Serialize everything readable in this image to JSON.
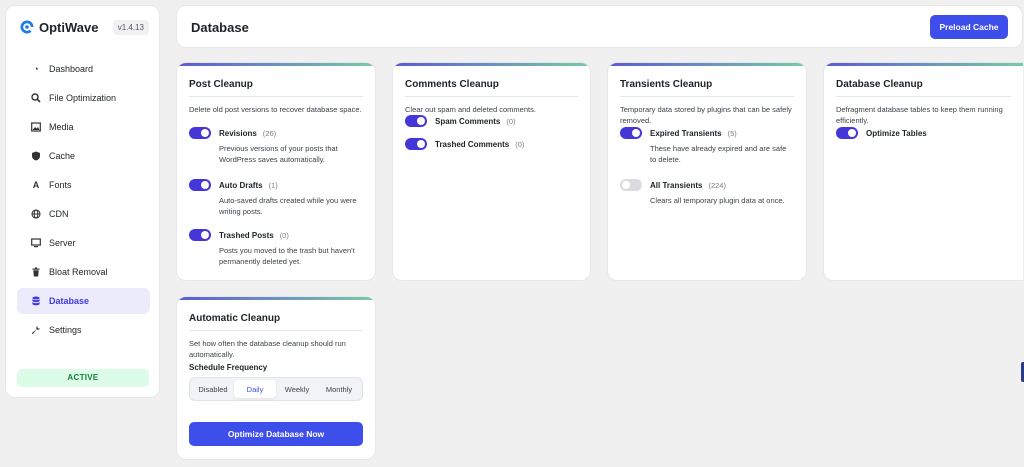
{
  "brand": {
    "name": "OptiWave",
    "version": "v1.4.13"
  },
  "sidebar": {
    "items": [
      {
        "label": "Dashboard",
        "icon": "dashboard-icon"
      },
      {
        "label": "File Optimization",
        "icon": "search-icon"
      },
      {
        "label": "Media",
        "icon": "image-icon"
      },
      {
        "label": "Cache",
        "icon": "shield-icon"
      },
      {
        "label": "Fonts",
        "icon": "font-icon"
      },
      {
        "label": "CDN",
        "icon": "globe-icon"
      },
      {
        "label": "Server",
        "icon": "monitor-icon"
      },
      {
        "label": "Bloat Removal",
        "icon": "trash-icon"
      },
      {
        "label": "Database",
        "icon": "database-icon",
        "active": true
      },
      {
        "label": "Settings",
        "icon": "wrench-icon"
      }
    ],
    "status": "ACTIVE"
  },
  "header": {
    "title": "Database",
    "preload_label": "Preload Cache"
  },
  "cards": {
    "post": {
      "title": "Post Cleanup",
      "desc": "Delete old post versions to recover database space.",
      "options": [
        {
          "label": "Revisions",
          "count": "(26)",
          "desc": "Previous versions of your posts that WordPress saves automatically.",
          "on": true
        },
        {
          "label": "Auto Drafts",
          "count": "(1)",
          "desc": "Auto-saved drafts created while you were writing posts.",
          "on": true
        },
        {
          "label": "Trashed Posts",
          "count": "(0)",
          "desc": "Posts you moved to the trash but haven't permanently deleted yet.",
          "on": true
        }
      ]
    },
    "comments": {
      "title": "Comments Cleanup",
      "desc": "Clear out spam and deleted comments.",
      "options": [
        {
          "label": "Spam Comments",
          "count": "(0)",
          "on": true
        },
        {
          "label": "Trashed Comments",
          "count": "(0)",
          "on": true
        }
      ]
    },
    "transients": {
      "title": "Transients Cleanup",
      "desc": "Temporary data stored by plugins that can be safely removed.",
      "options": [
        {
          "label": "Expired Transients",
          "count": "(5)",
          "desc": "These have already expired and are safe to delete.",
          "on": true
        },
        {
          "label": "All Transients",
          "count": "(224)",
          "desc": "Clears all temporary plugin data at once.",
          "on": false
        }
      ]
    },
    "database": {
      "title": "Database Cleanup",
      "desc": "Defragment database tables to keep them running efficiently.",
      "options": [
        {
          "label": "Optimize Tables",
          "on": true
        }
      ]
    },
    "automatic": {
      "title": "Automatic Cleanup",
      "desc": "Set how often the database cleanup should run automatically.",
      "frequency_label": "Schedule Frequency",
      "frequencies": [
        "Disabled",
        "Daily",
        "Weekly",
        "Monthly"
      ],
      "selected": "Daily",
      "button_label": "Optimize Database Now"
    }
  },
  "colors": {
    "accent": "#3d4eea",
    "toggle_on": "#4536d8",
    "active_bg": "#dcfce7",
    "active_text": "#15803d"
  }
}
